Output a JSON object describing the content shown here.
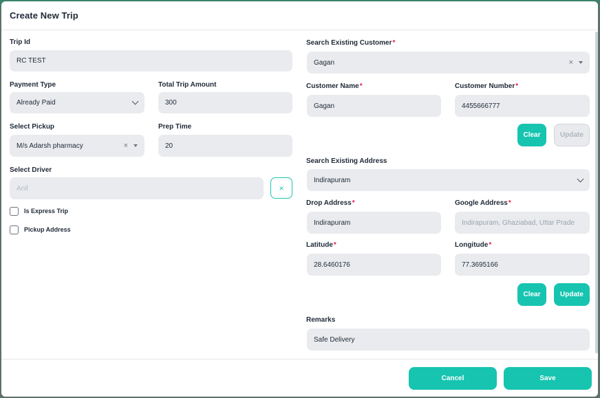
{
  "modal": {
    "title": "Create New Trip"
  },
  "left": {
    "trip_id": {
      "label": "Trip Id",
      "value": "RC TEST"
    },
    "payment_type": {
      "label": "Payment Type",
      "value": "Already Paid"
    },
    "total_trip_amount": {
      "label": "Total Trip Amount",
      "value": "300"
    },
    "select_pickup": {
      "label": "Select Pickup",
      "value": "M/s Adarsh pharmacy"
    },
    "prep_time": {
      "label": "Prep Time",
      "value": "20"
    },
    "select_driver": {
      "label": "Select Driver",
      "value": "Anil"
    },
    "clear_driver_icon": "×",
    "is_express_trip": {
      "label": "Is Express Trip",
      "checked": false
    },
    "pickup_address": {
      "label": "Pickup Address",
      "checked": false
    }
  },
  "right": {
    "search_customer": {
      "label": "Search Existing Customer",
      "required": "*",
      "value": "Gagan"
    },
    "customer_name": {
      "label": "Customer Name",
      "required": "*",
      "value": "Gagan"
    },
    "customer_number": {
      "label": "Customer Number",
      "required": "*",
      "value": "4455666777"
    },
    "customer_buttons": {
      "clear": "Clear",
      "update": "Update"
    },
    "search_address": {
      "label": "Search Existing Address",
      "value": "Indirapuram"
    },
    "drop_address": {
      "label": "Drop Address",
      "required": "*",
      "value": "Indirapuram"
    },
    "google_address": {
      "label": "Google Address",
      "required": "*",
      "value": "Indirapuram, Ghaziabad, Uttar Prade"
    },
    "latitude": {
      "label": "Latitude",
      "required": "*",
      "value": "28.6460176"
    },
    "longitude": {
      "label": "Longitude",
      "required": "*",
      "value": "77.3695166"
    },
    "address_buttons": {
      "clear": "Clear",
      "update": "Update"
    },
    "remarks": {
      "label": "Remarks",
      "value": "Safe Delivery"
    }
  },
  "footer": {
    "cancel": "Cancel",
    "save": "Save"
  },
  "icons": {
    "clear": "×"
  },
  "colors": {
    "accent": "#17c4b0",
    "required": "#e11d48",
    "input_bg": "#e9ebee"
  }
}
